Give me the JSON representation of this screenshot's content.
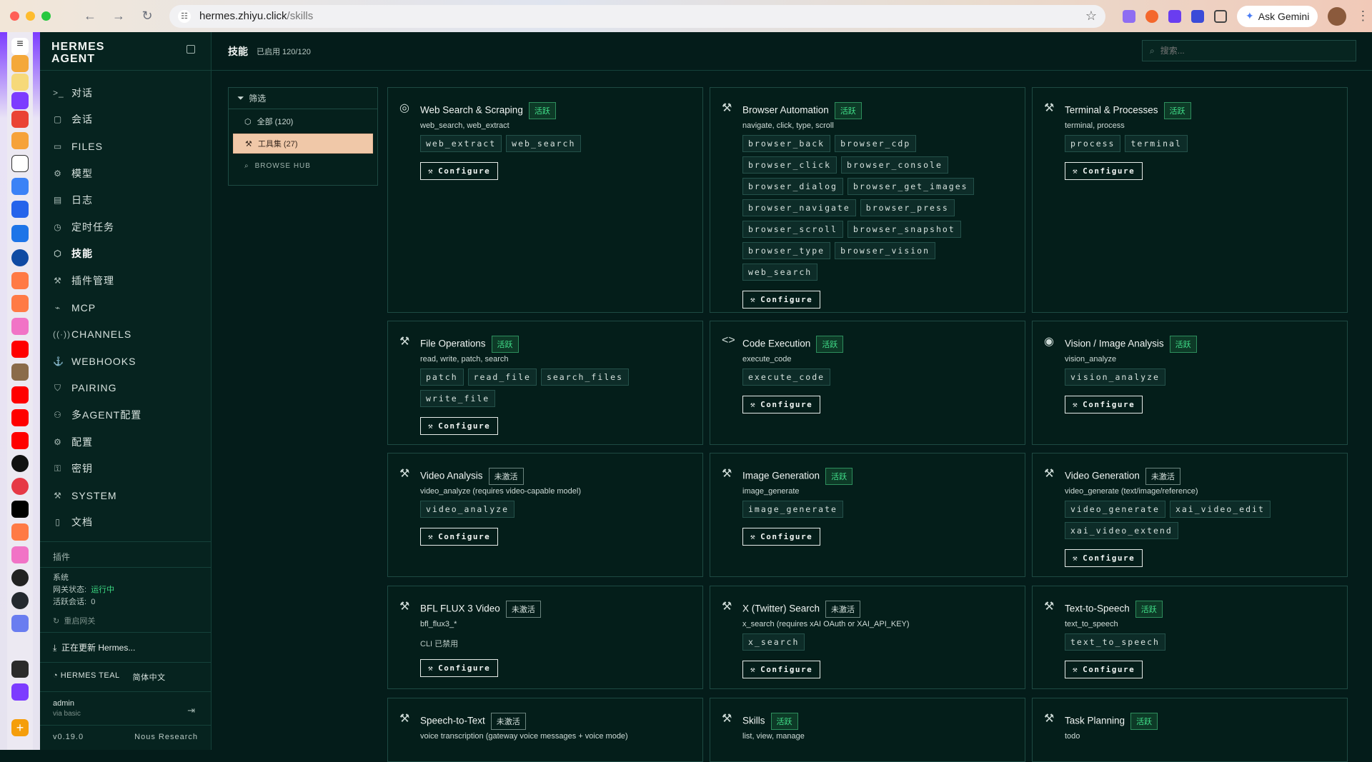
{
  "browser": {
    "url_host": "hermes.zhiyu.click",
    "url_path": "/skills",
    "gemini_label": "Ask Gemini"
  },
  "sidebar": {
    "brand_line1": "HERMES",
    "brand_line2": "AGENT",
    "items": [
      {
        "icon": ">_",
        "label": "对话"
      },
      {
        "icon": "▢",
        "label": "会话"
      },
      {
        "icon": "▭",
        "label": "FILES"
      },
      {
        "icon": "⚙",
        "label": "模型"
      },
      {
        "icon": "▤",
        "label": "日志"
      },
      {
        "icon": "◷",
        "label": "定时任务"
      },
      {
        "icon": "⬡",
        "label": "技能"
      },
      {
        "icon": "⚒",
        "label": "插件管理"
      },
      {
        "icon": "⌁",
        "label": "MCP"
      },
      {
        "icon": "((·))",
        "label": "CHANNELS"
      },
      {
        "icon": "⚓",
        "label": "WEBHOOKS"
      },
      {
        "icon": "⛉",
        "label": "PAIRING"
      },
      {
        "icon": "⚇",
        "label": "多AGENT配置"
      },
      {
        "icon": "⚙",
        "label": "配置"
      },
      {
        "icon": "⚿",
        "label": "密钥"
      },
      {
        "icon": "⚒",
        "label": "SYSTEM"
      },
      {
        "icon": "▯",
        "label": "文档"
      }
    ],
    "plugins_label": "插件",
    "system_label": "系统",
    "gateway_label": "网关状态:",
    "gateway_value": "运行中",
    "sessions_label": "活跃会话:",
    "sessions_value": "0",
    "restart_label": "重启网关",
    "update_label": "正在更新 Hermes...",
    "theme_label": "HERMES TEAL",
    "lang_label": "简体中文",
    "user_name": "admin",
    "user_sub": "via basic",
    "version": "v0.19.0",
    "org": "Nous Research"
  },
  "header": {
    "title": "技能",
    "enabled_count": "已启用 120/120",
    "search_placeholder": "搜索..."
  },
  "filter": {
    "title": "筛选",
    "all": "全部 (120)",
    "toolsets": "工具集 (27)",
    "hub": "BROWSE HUB"
  },
  "colors": {
    "accent_active": "#41e08a",
    "background": "#041c1a",
    "selected_filter": "#f0c8a8"
  },
  "configure_label": "Configure",
  "cards": [
    {
      "icon": "globe-icon",
      "name": "Web Search & Scraping",
      "status": "活跃",
      "active": true,
      "desc": "web_search, web_extract",
      "tags": [
        "web_extract",
        "web_search"
      ]
    },
    {
      "icon": "wrench-icon",
      "name": "Browser Automation",
      "status": "活跃",
      "active": true,
      "desc": "navigate, click, type, scroll",
      "tags": [
        "browser_back",
        "browser_cdp",
        "browser_click",
        "browser_console",
        "browser_dialog",
        "browser_get_images",
        "browser_navigate",
        "browser_press",
        "browser_scroll",
        "browser_snapshot",
        "browser_type",
        "browser_vision",
        "web_search"
      ]
    },
    {
      "icon": "wrench-icon",
      "name": "Terminal & Processes",
      "status": "活跃",
      "active": true,
      "desc": "terminal, process",
      "tags": [
        "process",
        "terminal"
      ]
    },
    {
      "icon": "wrench-icon",
      "name": "File Operations",
      "status": "活跃",
      "active": true,
      "desc": "read, write, patch, search",
      "tags": [
        "patch",
        "read_file",
        "search_files",
        "write_file"
      ]
    },
    {
      "icon": "code-icon",
      "name": "Code Execution",
      "status": "活跃",
      "active": true,
      "desc": "execute_code",
      "tags": [
        "execute_code"
      ]
    },
    {
      "icon": "eye-icon",
      "name": "Vision / Image Analysis",
      "status": "活跃",
      "active": true,
      "desc": "vision_analyze",
      "tags": [
        "vision_analyze"
      ]
    },
    {
      "icon": "wrench-icon",
      "name": "Video Analysis",
      "status": "未激活",
      "active": false,
      "desc": "video_analyze (requires video-capable model)",
      "tags": [
        "video_analyze"
      ]
    },
    {
      "icon": "wrench-icon",
      "name": "Image Generation",
      "status": "活跃",
      "active": true,
      "desc": "image_generate",
      "tags": [
        "image_generate"
      ]
    },
    {
      "icon": "wrench-icon",
      "name": "Video Generation",
      "status": "未激活",
      "active": false,
      "desc": "video_generate (text/image/reference)",
      "tags": [
        "video_generate",
        "xai_video_edit",
        "xai_video_extend"
      ]
    },
    {
      "icon": "wrench-icon",
      "name": "BFL FLUX 3 Video",
      "status": "未激活",
      "active": false,
      "desc": "bfl_flux3_*",
      "tags": [],
      "note": "CLI 已禁用"
    },
    {
      "icon": "wrench-icon",
      "name": "X (Twitter) Search",
      "status": "未激活",
      "active": false,
      "desc": "x_search (requires xAI OAuth or XAI_API_KEY)",
      "tags": [
        "x_search"
      ]
    },
    {
      "icon": "wrench-icon",
      "name": "Text-to-Speech",
      "status": "活跃",
      "active": true,
      "desc": "text_to_speech",
      "tags": [
        "text_to_speech"
      ]
    },
    {
      "icon": "wrench-icon",
      "name": "Speech-to-Text",
      "status": "未激活",
      "active": false,
      "desc": "voice transcription (gateway voice messages + voice mode)",
      "tags": []
    },
    {
      "icon": "wrench-icon",
      "name": "Skills",
      "status": "活跃",
      "active": true,
      "desc": "list, view, manage",
      "tags": []
    },
    {
      "icon": "wrench-icon",
      "name": "Task Planning",
      "status": "活跃",
      "active": true,
      "desc": "todo",
      "tags": []
    }
  ]
}
